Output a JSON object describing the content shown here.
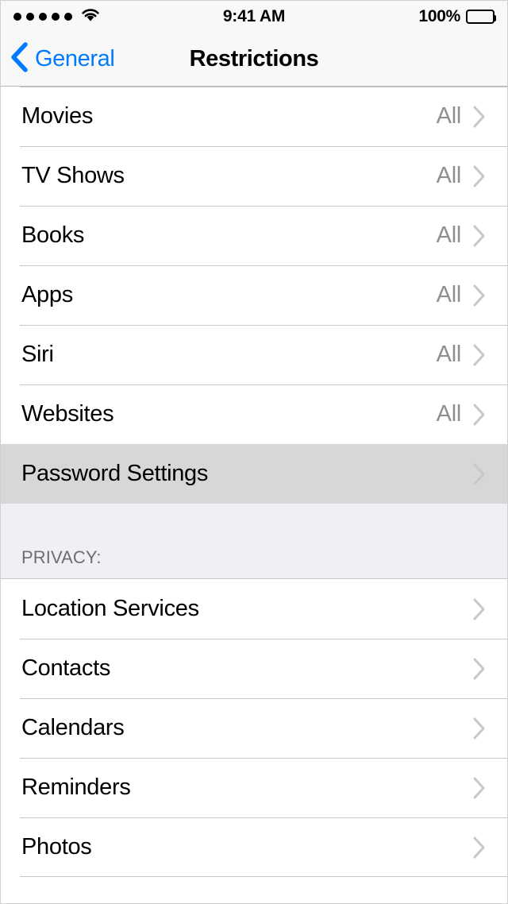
{
  "status_bar": {
    "signal_dots": 5,
    "wifi_icon": "wifi-icon",
    "time": "9:41 AM",
    "battery_percent": "100%",
    "battery_level": 100
  },
  "nav_bar": {
    "back_label": "General",
    "back_icon": "chevron-left-icon",
    "title": "Restrictions",
    "accent_color": "#007aff"
  },
  "colors": {
    "separator": "#c8c7cc",
    "row_background": "#ffffff",
    "highlight_background": "#d7d7d7",
    "section_background": "#efeff4",
    "value_text": "#8e8e93",
    "header_text": "#6d6d72",
    "chevron": "#c7c7cc"
  },
  "sections": [
    {
      "header": null,
      "rows": [
        {
          "label": "Movies",
          "value": "All",
          "accessory": "chevron-right-icon",
          "highlighted": false
        },
        {
          "label": "TV Shows",
          "value": "All",
          "accessory": "chevron-right-icon",
          "highlighted": false
        },
        {
          "label": "Books",
          "value": "All",
          "accessory": "chevron-right-icon",
          "highlighted": false
        },
        {
          "label": "Apps",
          "value": "All",
          "accessory": "chevron-right-icon",
          "highlighted": false
        },
        {
          "label": "Siri",
          "value": "All",
          "accessory": "chevron-right-icon",
          "highlighted": false
        },
        {
          "label": "Websites",
          "value": "All",
          "accessory": "chevron-right-icon",
          "highlighted": false
        },
        {
          "label": "Password Settings",
          "value": "",
          "accessory": "chevron-right-icon",
          "highlighted": true
        }
      ]
    },
    {
      "header": "PRIVACY:",
      "rows": [
        {
          "label": "Location Services",
          "value": "",
          "accessory": "chevron-right-icon",
          "highlighted": false
        },
        {
          "label": "Contacts",
          "value": "",
          "accessory": "chevron-right-icon",
          "highlighted": false
        },
        {
          "label": "Calendars",
          "value": "",
          "accessory": "chevron-right-icon",
          "highlighted": false
        },
        {
          "label": "Reminders",
          "value": "",
          "accessory": "chevron-right-icon",
          "highlighted": false
        },
        {
          "label": "Photos",
          "value": "",
          "accessory": "chevron-right-icon",
          "highlighted": false
        }
      ]
    }
  ]
}
